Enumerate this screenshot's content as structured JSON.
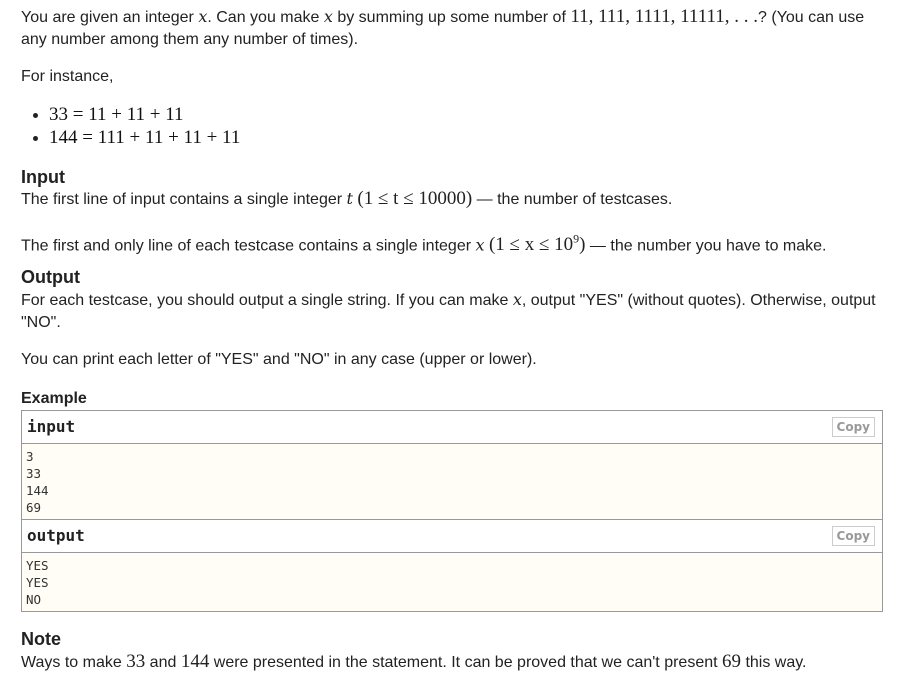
{
  "statement": {
    "intro": {
      "t1": "You are given an integer ",
      "var_x": "x",
      "t2": ". Can you make ",
      "t3": " by summing up some number of ",
      "numbers": "11, 111, 1111, 11111, . . .",
      "t4": "? (You can use any number among them any number of times)."
    },
    "for_instance": "For instance,",
    "examples": [
      "33 = 11 + 11 + 11",
      "144 = 111 + 11 + 11 + 11"
    ]
  },
  "input_section": {
    "title": "Input",
    "line1_text": "The first line of input contains a single integer ",
    "line1_var": "t",
    "line1_math": "(1 ≤ t ≤ 10000)",
    "line1_tail": " — the number of testcases.",
    "line2_text": "The first and only line of each testcase contains a single integer ",
    "line2_var": "x",
    "line2_math_a": "(1 ≤ x ≤ 10",
    "line2_math_sup": "9",
    "line2_math_b": ")",
    "line2_tail": " — the number you have to make."
  },
  "output_section": {
    "title": "Output",
    "line1_a": "For each testcase, you should output a single string. If you can make ",
    "line1_var": "x",
    "line1_b": ", output \"YES\" (without quotes). Otherwise, output \"NO\".",
    "line2": "You can print each letter of \"YES\" and \"NO\" in any case (upper or lower)."
  },
  "example": {
    "title": "Example",
    "input_label": "input",
    "output_label": "output",
    "copy_label": "Copy",
    "input_lines": [
      "3",
      "33",
      "144",
      "69"
    ],
    "output_lines": [
      "YES",
      "YES",
      "NO"
    ]
  },
  "note": {
    "title": "Note",
    "t1": "Ways to make ",
    "n1": "33",
    "t2": " and ",
    "n2": "144",
    "t3": " were presented in the statement. It can be proved that we can't present ",
    "n3": "69",
    "t4": " this way."
  }
}
